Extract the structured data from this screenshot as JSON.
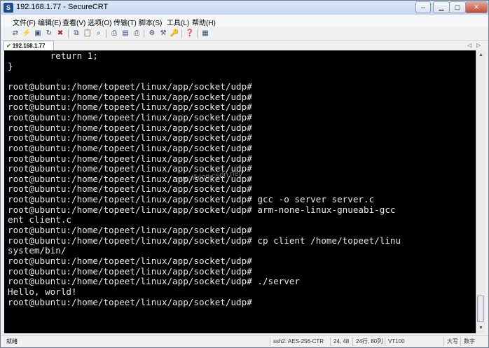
{
  "window": {
    "title": "192.168.1.77 - SecureCRT",
    "app_icon": "securecrt-icon"
  },
  "menu": [
    {
      "label": "文件(F)"
    },
    {
      "label": "编辑(E)"
    },
    {
      "label": "查看(V)"
    },
    {
      "label": "选项(O)"
    },
    {
      "label": "传输(T)"
    },
    {
      "label": "脚本(S)"
    },
    {
      "label": "工具(L)"
    },
    {
      "label": "帮助(H)"
    }
  ],
  "tab": {
    "label": "192.168.1.77"
  },
  "terminal": {
    "lines": [
      "        return 1;",
      "}",
      "",
      "root@ubuntu:/home/topeet/linux/app/socket/udp#",
      "root@ubuntu:/home/topeet/linux/app/socket/udp#",
      "root@ubuntu:/home/topeet/linux/app/socket/udp#",
      "root@ubuntu:/home/topeet/linux/app/socket/udp#",
      "root@ubuntu:/home/topeet/linux/app/socket/udp#",
      "root@ubuntu:/home/topeet/linux/app/socket/udp#",
      "root@ubuntu:/home/topeet/linux/app/socket/udp#",
      "root@ubuntu:/home/topeet/linux/app/socket/udp#",
      "root@ubuntu:/home/topeet/linux/app/socket/udp#",
      "root@ubuntu:/home/topeet/linux/app/socket/udp#",
      "root@ubuntu:/home/topeet/linux/app/socket/udp#",
      "root@ubuntu:/home/topeet/linux/app/socket/udp# gcc -o server server.c",
      "root@ubuntu:/home/topeet/linux/app/socket/udp# arm-none-linux-gnueabi-gcc",
      "ent client.c",
      "root@ubuntu:/home/topeet/linux/app/socket/udp#",
      "root@ubuntu:/home/topeet/linux/app/socket/udp# cp client /home/topeet/linu",
      "system/bin/",
      "root@ubuntu:/home/topeet/linux/app/socket/udp#",
      "root@ubuntu:/home/topeet/linux/app/socket/udp#",
      "root@ubuntu:/home/topeet/linux/app/socket/udp# ./server",
      "Hello, world!",
      "root@ubuntu:/home/topeet/linux/app/socket/udp#"
    ],
    "watermark": "http://blog.csdn.net/"
  },
  "status": {
    "ready": "就绪",
    "encryption": "ssh2: AES-256-CTR",
    "cursor": "24, 48",
    "size": "24行, 80列",
    "term_type": "VT100",
    "caps": "大写",
    "num": "数字"
  },
  "colors": {
    "terminal_bg": "#000000",
    "terminal_fg": "#e8e8e8",
    "titlebar": "#c5d8ef"
  }
}
